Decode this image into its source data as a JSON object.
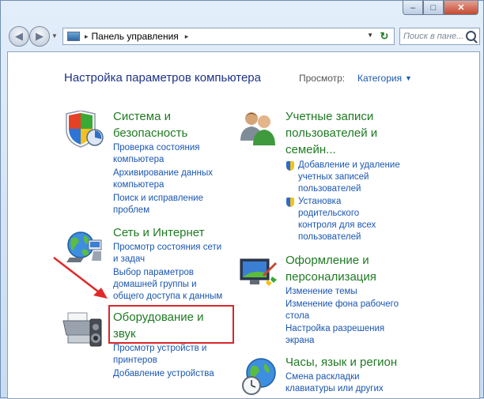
{
  "window": {
    "caption_buttons": {
      "minimize": "–",
      "maximize": "□",
      "close": "✕"
    }
  },
  "toolbar": {
    "back": "◀",
    "forward": "▶",
    "address_arrow": "▸",
    "address_text": "Панель управления",
    "address_arrow2": "▸",
    "refresh": "↻",
    "search_placeholder": "Поиск в пане..."
  },
  "header": {
    "title": "Настройка параметров компьютера",
    "view_label": "Просмотр:",
    "view_value": "Категория"
  },
  "categories": {
    "system": {
      "title_line1": "Система и",
      "title_line2": "безопасность",
      "links": [
        "Проверка состояния",
        "компьютера",
        "Архивирование данных",
        "компьютера",
        "Поиск и исправление",
        "проблем"
      ]
    },
    "network": {
      "title": "Сеть и Интернет",
      "links": [
        "Просмотр состояния сети",
        "и задач",
        "Выбор параметров",
        "домашней группы и",
        "общего доступа к данным"
      ]
    },
    "hardware": {
      "title_line1": "Оборудование и",
      "title_line2": "звук",
      "links": [
        "Просмотр устройств и",
        "принтеров",
        "Добавление устройства"
      ]
    },
    "accounts": {
      "title_line1": "Учетные записи",
      "title_line2": "пользователей и",
      "title_line3": "семейн...",
      "links": [
        "Добавление и удаление",
        "учетных записей",
        "пользователей",
        "Установка",
        "родительского",
        "контроля для всех",
        "пользователей"
      ]
    },
    "appearance": {
      "title_line1": "Оформление и",
      "title_line2": "персонализация",
      "links": [
        "Изменение темы",
        "Изменение фона рабочего",
        "стола",
        "Настройка разрешения",
        "экрана"
      ]
    },
    "clock": {
      "title": "Часы, язык и регион",
      "links": [
        "Смена раскладки",
        "клавиатуры или других"
      ]
    }
  },
  "colors": {
    "heading_green": "#1f7a23",
    "link_blue": "#1a56b0",
    "title_blue": "#1e3287",
    "highlight_red": "#d8272b"
  }
}
